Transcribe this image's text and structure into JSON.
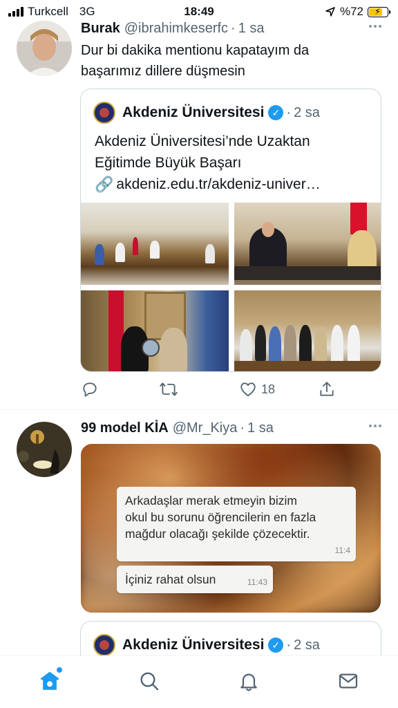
{
  "status_bar": {
    "carrier": "Turkcell",
    "network": "3G",
    "time": "18:49",
    "battery_text": "%72",
    "battery_level": 0.72,
    "battery_color": "#f7c600"
  },
  "tweet1": {
    "name": "Burak",
    "handle": "@ibrahimkeserfc",
    "dot": "·",
    "time": "1 sa",
    "text_line1": "Dur bi dakika mentionu kapatayım da",
    "text_line2": "başarımız dillere düşmesin",
    "quote": {
      "name": "Akdeniz Üniversitesi",
      "verified_icon": "✓",
      "dot": "·",
      "time": "2 sa",
      "text_line1": "Akdeniz Üniversitesi’nde Uzaktan",
      "text_line2": "Eğitimde Büyük Başarı",
      "link": "akdeniz.edu.tr/akdeniz-univer…",
      "link_icon": "🔗"
    },
    "actions": {
      "likes": "18"
    }
  },
  "tweet2": {
    "name": "99 model KİA",
    "handle": "@Mr_Kiya",
    "dot": "·",
    "time": "1 sa",
    "image_messages": {
      "msg1_line1": "Arkadaşlar merak etmeyin bizim",
      "msg1_line2": "okul bu sorunu öğrencilerin en fazla",
      "msg1_line3": "mağdur olacağı şekilde çözecektir.",
      "msg1_time": "11:4",
      "msg2": "İçiniz rahat olsun",
      "msg2_time": "11:43"
    },
    "quote": {
      "name": "Akdeniz Üniversitesi",
      "verified_icon": "✓",
      "dot": "·",
      "time": "2 sa"
    }
  },
  "colors": {
    "accent": "#1d9bf0",
    "secondary_text": "#536471",
    "border": "#cfd9de"
  },
  "icons": [
    "reply-icon",
    "retweet-icon",
    "like-icon",
    "share-icon",
    "home-icon",
    "search-icon",
    "notifications-icon",
    "messages-icon",
    "more-icon",
    "verified-icon",
    "link-icon"
  ]
}
